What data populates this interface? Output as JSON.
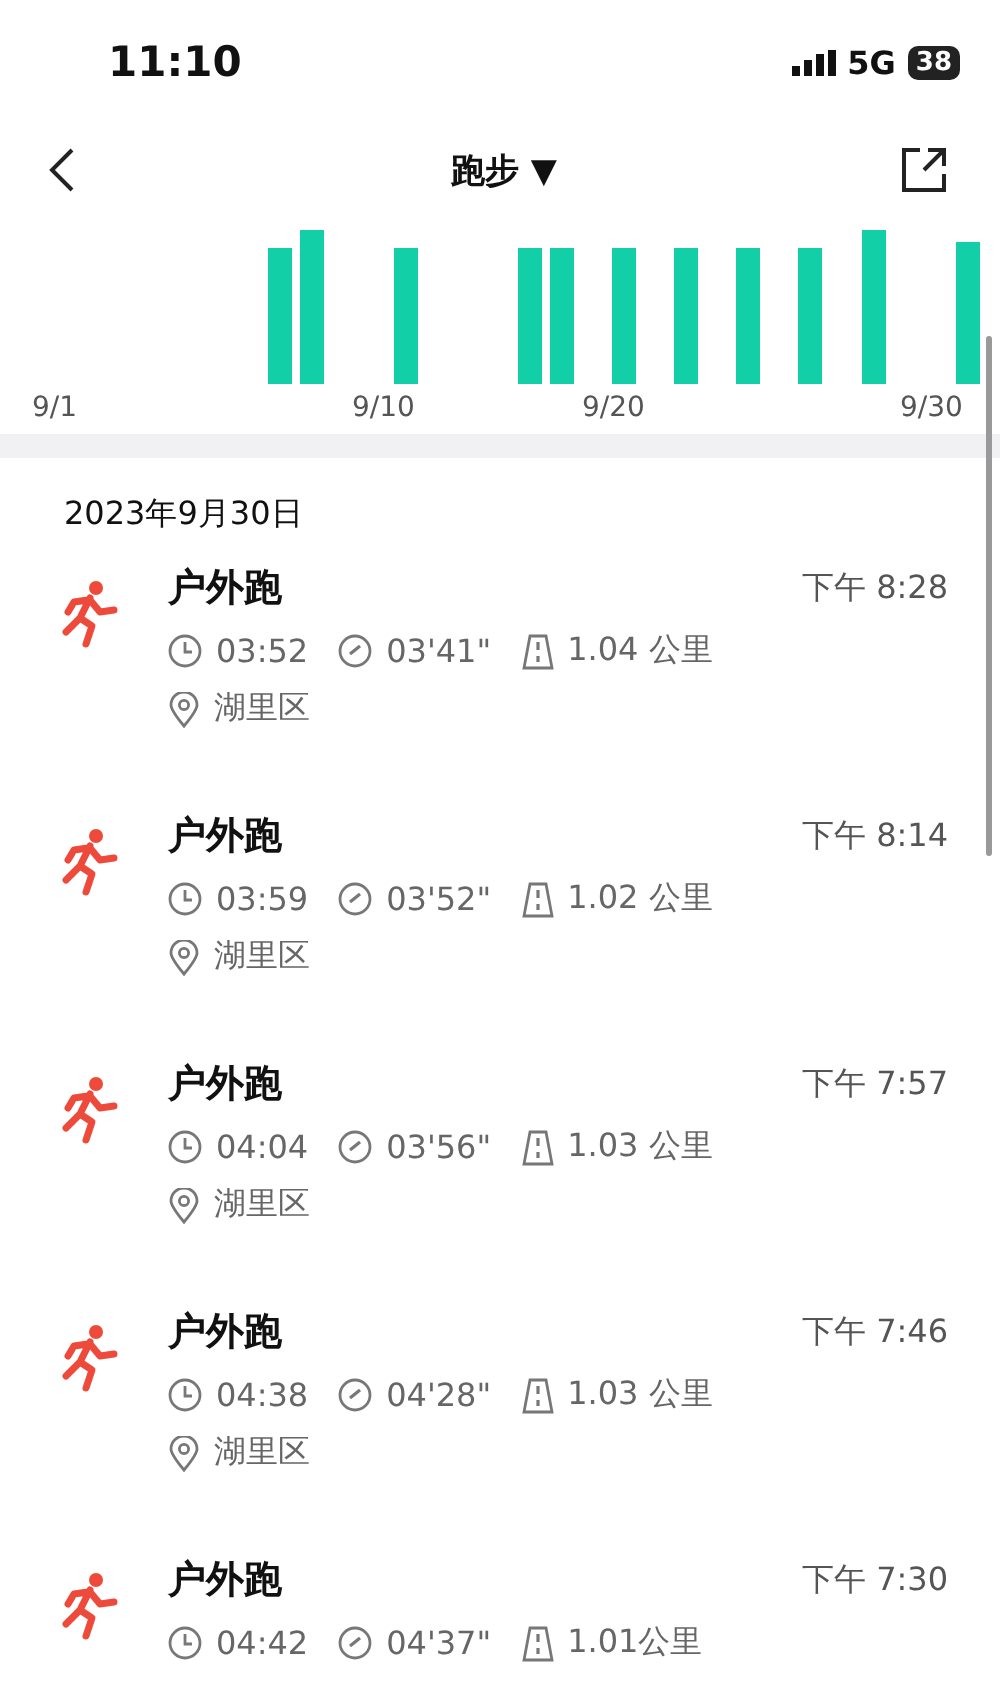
{
  "status_bar": {
    "time": "11:10",
    "network": "5G",
    "battery": "38"
  },
  "nav": {
    "title": "跑步",
    "caret": "▼"
  },
  "chart": {
    "date_labels": [
      "9/1",
      "9/10",
      "9/20",
      "9/30"
    ]
  },
  "date_header": "2023年9月30日",
  "records": [
    {
      "type": "户外跑",
      "time": "下午 8:28",
      "duration": "03:52",
      "pace": "03'41\"",
      "distance": "1.04 公里",
      "place": "湖里区"
    },
    {
      "type": "户外跑",
      "time": "下午 8:14",
      "duration": "03:59",
      "pace": "03'52\"",
      "distance": "1.02 公里",
      "place": "湖里区"
    },
    {
      "type": "户外跑",
      "time": "下午 7:57",
      "duration": "04:04",
      "pace": "03'56\"",
      "distance": "1.03 公里",
      "place": "湖里区"
    },
    {
      "type": "户外跑",
      "time": "下午 7:46",
      "duration": "04:38",
      "pace": "04'28\"",
      "distance": "1.03 公里",
      "place": "湖里区"
    },
    {
      "type": "户外跑",
      "time": "下午 7:30",
      "duration": "04:42",
      "pace": "04'37\"",
      "distance": "1.01公里"
    }
  ]
}
